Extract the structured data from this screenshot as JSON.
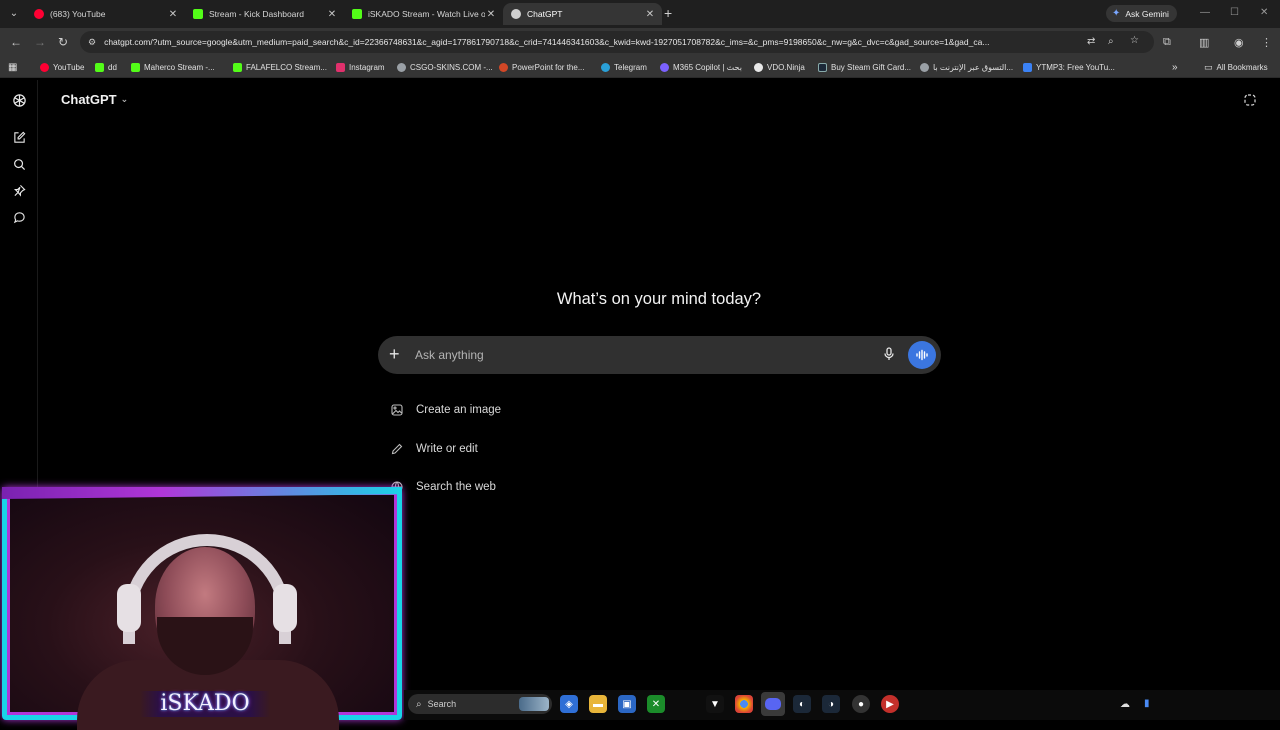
{
  "browser": {
    "tabs": [
      {
        "title": "(683) YouTube",
        "favicon_color": "#ff0033",
        "active": false
      },
      {
        "title": "Stream - Kick Dashboard",
        "favicon_color": "#53fc18",
        "active": false
      },
      {
        "title": "iSKADO Stream - Watch Live on",
        "favicon_color": "#53fc18",
        "active": false
      },
      {
        "title": "ChatGPT",
        "favicon_color": "#d0d0d0",
        "active": true
      }
    ],
    "ask_gemini_label": "Ask Gemini",
    "url": "chatgpt.com/?utm_source=google&utm_medium=paid_search&c_id=22366748631&c_agid=177861790718&c_crid=741446341603&c_kwid=kwd-1927051708782&c_ims=&c_pms=9198650&c_nw=g&c_dvc=c&gad_source=1&gad_ca...",
    "bookmarks": [
      {
        "label": "YouTube",
        "color": "#ff0033"
      },
      {
        "label": "dd",
        "color": "#53fc18"
      },
      {
        "label": "Maherco Stream -...",
        "color": "#53fc18"
      },
      {
        "label": "FALAFELCO Stream...",
        "color": "#53fc18"
      },
      {
        "label": "Instagram",
        "color": "#e1306c"
      },
      {
        "label": "CSGO-SKINS.COM -...",
        "color": "#9aa0a6"
      },
      {
        "label": "PowerPoint for the...",
        "color": "#d24726"
      },
      {
        "label": "Telegram",
        "color": "#2aa0d8"
      },
      {
        "label": "M365 Copilot | بحث",
        "color": "#7b61ff"
      },
      {
        "label": "VDO.Ninja",
        "color": "#e8e8e8"
      },
      {
        "label": "Buy Steam Gift Card...",
        "color": "#1b2838"
      },
      {
        "label": "التسوق عبر الإنترنت با...",
        "color": "#9aa0a6"
      },
      {
        "label": "YTMP3: Free YouTu...",
        "color": "#3b82f6"
      }
    ],
    "all_bookmarks_label": "All Bookmarks"
  },
  "chat": {
    "model_label": "ChatGPT",
    "heading": "What’s on your mind today?",
    "composer_placeholder": "Ask anything",
    "suggestions": [
      {
        "label": "Create an image",
        "icon": "image-icon"
      },
      {
        "label": "Write or edit",
        "icon": "pencil-icon"
      },
      {
        "label": "Search the web",
        "icon": "globe-icon"
      }
    ],
    "accent_color": "#3b76e0"
  },
  "webcam": {
    "name": "iSKADO"
  },
  "taskbar": {
    "search_placeholder": "Search"
  }
}
